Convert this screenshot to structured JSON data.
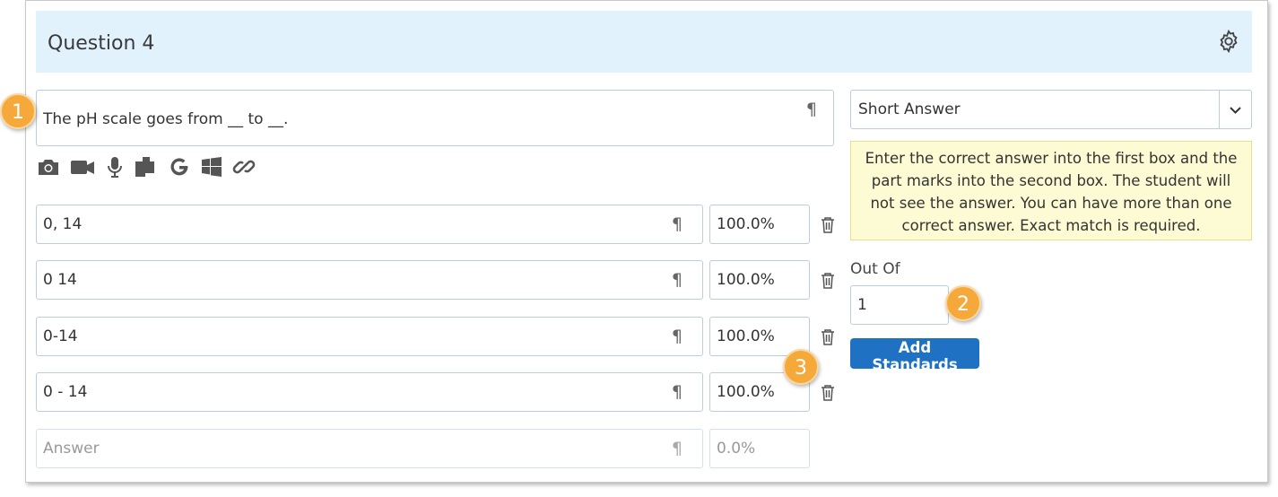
{
  "question": {
    "title": "Question 4",
    "prompt": "The pH scale goes from __ to __.",
    "paragraph_glyph": "¶"
  },
  "answers": [
    {
      "value": "0, 14",
      "marks": "100.0%"
    },
    {
      "value": "0 14",
      "marks": "100.0%"
    },
    {
      "value": "0-14",
      "marks": "100.0%"
    },
    {
      "value": "0 - 14",
      "marks": "100.0%"
    }
  ],
  "new_answer": {
    "placeholder": "Answer",
    "marks_placeholder": "0.0%"
  },
  "question_type": {
    "selected": "Short Answer"
  },
  "hint_text": "Enter the correct answer into the first box and the part marks into the second box. The student will not see the answer. You can have more than one correct answer. Exact match is required.",
  "out_of": {
    "label": "Out Of",
    "value": "1"
  },
  "add_standards_label": "Add Standards",
  "callouts": [
    "1",
    "2",
    "3"
  ],
  "toolbar_icons": [
    "camera-icon",
    "video-icon",
    "microphone-icon",
    "copy-icon",
    "google-icon",
    "windows-icon",
    "link-icon"
  ],
  "colors": {
    "header_bg": "#e2f2fd",
    "button": "#1f71c4",
    "hint_bg": "#fdfbd3",
    "callout": "#f6a93b"
  }
}
